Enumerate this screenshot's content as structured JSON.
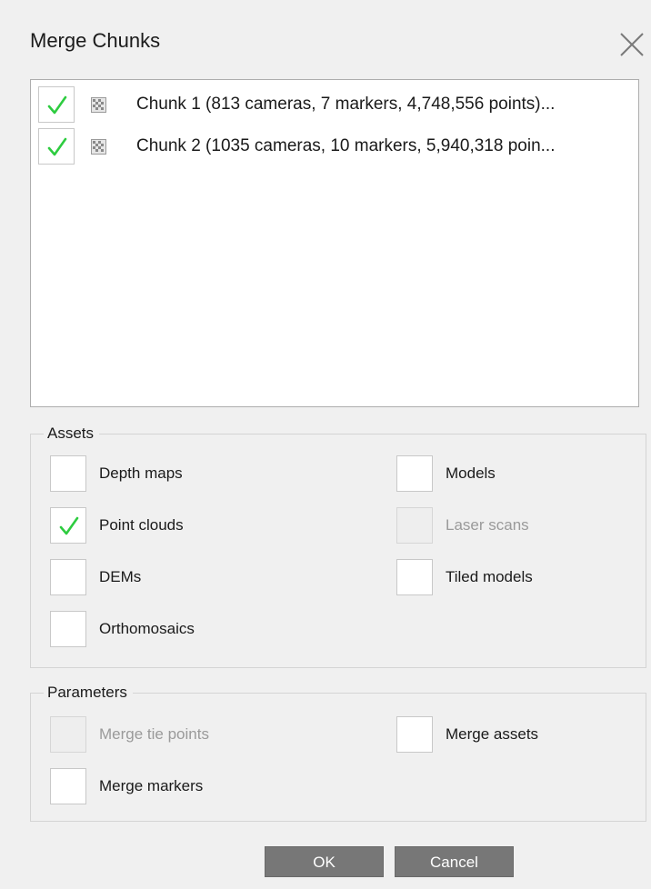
{
  "dialog": {
    "title": "Merge Chunks",
    "close_icon": "close-icon"
  },
  "chunks": [
    {
      "label": "Chunk 1 (813 cameras, 7 markers, 4,748,556 points)...",
      "checked": true,
      "icon": "chunk-icon"
    },
    {
      "label": "Chunk 2 (1035 cameras, 10 markers, 5,940,318 poin...",
      "checked": true,
      "icon": "chunk-icon"
    }
  ],
  "assets": {
    "title": "Assets",
    "depth_maps": {
      "label": "Depth maps",
      "checked": false,
      "enabled": true
    },
    "models": {
      "label": "Models",
      "checked": false,
      "enabled": true
    },
    "point_clouds": {
      "label": "Point clouds",
      "checked": true,
      "enabled": true
    },
    "laser_scans": {
      "label": "Laser scans",
      "checked": false,
      "enabled": false
    },
    "dems": {
      "label": "DEMs",
      "checked": false,
      "enabled": true
    },
    "tiled_models": {
      "label": "Tiled models",
      "checked": false,
      "enabled": true
    },
    "orthomosaics": {
      "label": "Orthomosaics",
      "checked": false,
      "enabled": true
    }
  },
  "parameters": {
    "title": "Parameters",
    "merge_tie_points": {
      "label": "Merge tie points",
      "checked": false,
      "enabled": false
    },
    "merge_assets": {
      "label": "Merge assets",
      "checked": false,
      "enabled": true
    },
    "merge_markers": {
      "label": "Merge markers",
      "checked": false,
      "enabled": true
    }
  },
  "buttons": {
    "ok": "OK",
    "cancel": "Cancel"
  },
  "colors": {
    "check": "#2ecc40",
    "button": "#777777",
    "background": "#f0f0f0"
  }
}
